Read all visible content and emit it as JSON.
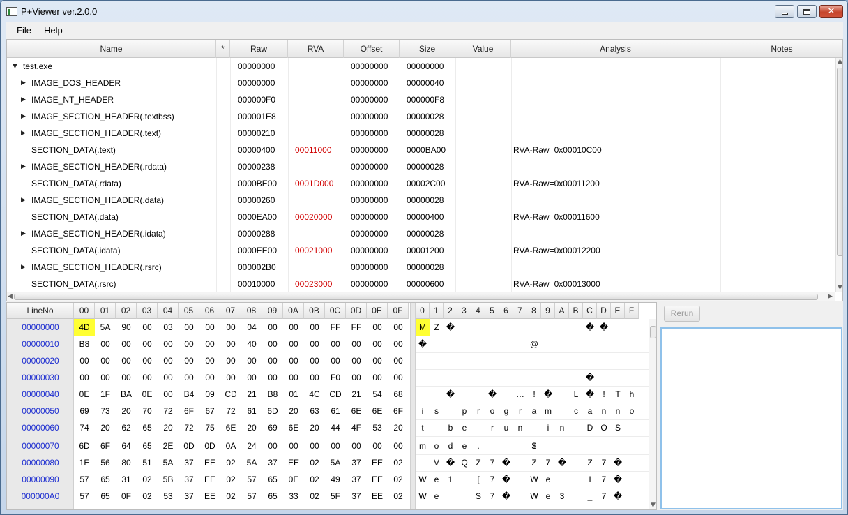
{
  "window": {
    "title": "P+Viewer ver.2.0.0"
  },
  "menu": [
    "File",
    "Help"
  ],
  "tree": {
    "columns": [
      "Name",
      "*",
      "Raw",
      "RVA",
      "Offset",
      "Size",
      "Value",
      "Analysis",
      "Notes"
    ],
    "rows": [
      {
        "level": 0,
        "expand": "open",
        "name": "test.exe",
        "raw": "00000000",
        "rva": "",
        "offset": "00000000",
        "size": "00000000",
        "analysis": ""
      },
      {
        "level": 1,
        "expand": "closed",
        "name": "IMAGE_DOS_HEADER",
        "raw": "00000000",
        "rva": "",
        "offset": "00000000",
        "size": "00000040",
        "analysis": ""
      },
      {
        "level": 1,
        "expand": "closed",
        "name": "IMAGE_NT_HEADER",
        "raw": "000000F0",
        "rva": "",
        "offset": "00000000",
        "size": "000000F8",
        "analysis": ""
      },
      {
        "level": 1,
        "expand": "closed",
        "name": "IMAGE_SECTION_HEADER(.textbss)",
        "raw": "000001E8",
        "rva": "",
        "offset": "00000000",
        "size": "00000028",
        "analysis": ""
      },
      {
        "level": 1,
        "expand": "closed",
        "name": "IMAGE_SECTION_HEADER(.text)",
        "raw": "00000210",
        "rva": "",
        "offset": "00000000",
        "size": "00000028",
        "analysis": ""
      },
      {
        "level": 1,
        "expand": "none",
        "name": "SECTION_DATA(.text)",
        "raw": "00000400",
        "rva": "00011000",
        "offset": "00000000",
        "size": "0000BA00",
        "analysis": "RVA-Raw=0x00010C00"
      },
      {
        "level": 1,
        "expand": "closed",
        "name": "IMAGE_SECTION_HEADER(.rdata)",
        "raw": "00000238",
        "rva": "",
        "offset": "00000000",
        "size": "00000028",
        "analysis": ""
      },
      {
        "level": 1,
        "expand": "none",
        "name": "SECTION_DATA(.rdata)",
        "raw": "0000BE00",
        "rva": "0001D000",
        "offset": "00000000",
        "size": "00002C00",
        "analysis": "RVA-Raw=0x00011200"
      },
      {
        "level": 1,
        "expand": "closed",
        "name": "IMAGE_SECTION_HEADER(.data)",
        "raw": "00000260",
        "rva": "",
        "offset": "00000000",
        "size": "00000028",
        "analysis": ""
      },
      {
        "level": 1,
        "expand": "none",
        "name": "SECTION_DATA(.data)",
        "raw": "0000EA00",
        "rva": "00020000",
        "offset": "00000000",
        "size": "00000400",
        "analysis": "RVA-Raw=0x00011600"
      },
      {
        "level": 1,
        "expand": "closed",
        "name": "IMAGE_SECTION_HEADER(.idata)",
        "raw": "00000288",
        "rva": "",
        "offset": "00000000",
        "size": "00000028",
        "analysis": ""
      },
      {
        "level": 1,
        "expand": "none",
        "name": "SECTION_DATA(.idata)",
        "raw": "0000EE00",
        "rva": "00021000",
        "offset": "00000000",
        "size": "00001200",
        "analysis": "RVA-Raw=0x00012200"
      },
      {
        "level": 1,
        "expand": "closed",
        "name": "IMAGE_SECTION_HEADER(.rsrc)",
        "raw": "000002B0",
        "rva": "",
        "offset": "00000000",
        "size": "00000028",
        "analysis": ""
      },
      {
        "level": 1,
        "expand": "none",
        "name": "SECTION_DATA(.rsrc)",
        "raw": "00010000",
        "rva": "00023000",
        "offset": "00000000",
        "size": "00000600",
        "analysis": "RVA-Raw=0x00013000"
      }
    ]
  },
  "hex": {
    "lineno_label": "LineNo",
    "byte_headers": [
      "00",
      "01",
      "02",
      "03",
      "04",
      "05",
      "06",
      "07",
      "08",
      "09",
      "0A",
      "0B",
      "0C",
      "0D",
      "0E",
      "0F"
    ],
    "ascii_headers": [
      "0",
      "1",
      "2",
      "3",
      "4",
      "5",
      "6",
      "7",
      "8",
      "9",
      "A",
      "B",
      "C",
      "D",
      "E",
      "F"
    ],
    "rows": [
      {
        "addr": "00000000",
        "bytes": [
          "4D",
          "5A",
          "90",
          "00",
          "03",
          "00",
          "00",
          "00",
          "04",
          "00",
          "00",
          "00",
          "FF",
          "FF",
          "00",
          "00"
        ],
        "ascii": [
          "M",
          "Z",
          "�",
          "",
          "",
          "",
          "",
          "",
          "",
          "",
          "",
          "",
          "�",
          "�",
          "",
          ""
        ]
      },
      {
        "addr": "00000010",
        "bytes": [
          "B8",
          "00",
          "00",
          "00",
          "00",
          "00",
          "00",
          "00",
          "40",
          "00",
          "00",
          "00",
          "00",
          "00",
          "00",
          "00"
        ],
        "ascii": [
          "�",
          "",
          "",
          "",
          "",
          "",
          "",
          "",
          "@",
          "",
          "",
          "",
          "",
          "",
          "",
          ""
        ]
      },
      {
        "addr": "00000020",
        "bytes": [
          "00",
          "00",
          "00",
          "00",
          "00",
          "00",
          "00",
          "00",
          "00",
          "00",
          "00",
          "00",
          "00",
          "00",
          "00",
          "00"
        ],
        "ascii": [
          "",
          "",
          "",
          "",
          "",
          "",
          "",
          "",
          "",
          "",
          "",
          "",
          "",
          "",
          "",
          ""
        ]
      },
      {
        "addr": "00000030",
        "bytes": [
          "00",
          "00",
          "00",
          "00",
          "00",
          "00",
          "00",
          "00",
          "00",
          "00",
          "00",
          "00",
          "F0",
          "00",
          "00",
          "00"
        ],
        "ascii": [
          "",
          "",
          "",
          "",
          "",
          "",
          "",
          "",
          "",
          "",
          "",
          "",
          "�",
          "",
          "",
          ""
        ]
      },
      {
        "addr": "00000040",
        "bytes": [
          "0E",
          "1F",
          "BA",
          "0E",
          "00",
          "B4",
          "09",
          "CD",
          "21",
          "B8",
          "01",
          "4C",
          "CD",
          "21",
          "54",
          "68"
        ],
        "ascii": [
          "",
          "",
          "�",
          "",
          "",
          "�",
          "",
          "…",
          "!",
          "�",
          "",
          "L",
          "�",
          "!",
          "T",
          "h"
        ]
      },
      {
        "addr": "00000050",
        "bytes": [
          "69",
          "73",
          "20",
          "70",
          "72",
          "6F",
          "67",
          "72",
          "61",
          "6D",
          "20",
          "63",
          "61",
          "6E",
          "6E",
          "6F"
        ],
        "ascii": [
          "i",
          "s",
          "",
          "p",
          "r",
          "o",
          "g",
          "r",
          "a",
          "m",
          "",
          "c",
          "a",
          "n",
          "n",
          "o"
        ]
      },
      {
        "addr": "00000060",
        "bytes": [
          "74",
          "20",
          "62",
          "65",
          "20",
          "72",
          "75",
          "6E",
          "20",
          "69",
          "6E",
          "20",
          "44",
          "4F",
          "53",
          "20"
        ],
        "ascii": [
          "t",
          "",
          "b",
          "e",
          "",
          "r",
          "u",
          "n",
          "",
          "i",
          "n",
          "",
          "D",
          "O",
          "S",
          ""
        ]
      },
      {
        "addr": "00000070",
        "bytes": [
          "6D",
          "6F",
          "64",
          "65",
          "2E",
          "0D",
          "0D",
          "0A",
          "24",
          "00",
          "00",
          "00",
          "00",
          "00",
          "00",
          "00"
        ],
        "ascii": [
          "m",
          "o",
          "d",
          "e",
          ".",
          "",
          "",
          "",
          "$",
          "",
          "",
          "",
          "",
          "",
          "",
          ""
        ]
      },
      {
        "addr": "00000080",
        "bytes": [
          "1E",
          "56",
          "80",
          "51",
          "5A",
          "37",
          "EE",
          "02",
          "5A",
          "37",
          "EE",
          "02",
          "5A",
          "37",
          "EE",
          "02"
        ],
        "ascii": [
          "",
          "V",
          "�",
          "Q",
          "Z",
          "7",
          "�",
          "",
          "Z",
          "7",
          "�",
          "",
          "Z",
          "7",
          "�",
          ""
        ]
      },
      {
        "addr": "00000090",
        "bytes": [
          "57",
          "65",
          "31",
          "02",
          "5B",
          "37",
          "EE",
          "02",
          "57",
          "65",
          "0E",
          "02",
          "49",
          "37",
          "EE",
          "02"
        ],
        "ascii": [
          "W",
          "e",
          "1",
          "",
          "[",
          "7",
          "�",
          "",
          "W",
          "e",
          "",
          "",
          "I",
          "7",
          "�",
          ""
        ]
      },
      {
        "addr": "000000A0",
        "bytes": [
          "57",
          "65",
          "0F",
          "02",
          "53",
          "37",
          "EE",
          "02",
          "57",
          "65",
          "33",
          "02",
          "5F",
          "37",
          "EE",
          "02"
        ],
        "ascii": [
          "W",
          "e",
          "",
          "",
          "S",
          "7",
          "�",
          "",
          "W",
          "e",
          "3",
          "",
          "_",
          "7",
          "�",
          ""
        ]
      }
    ]
  },
  "side": {
    "rerun_label": "Rerun"
  },
  "colors": {
    "address": "#1f2fd0",
    "rva": "#d00000",
    "highlight": "#ffff33"
  }
}
